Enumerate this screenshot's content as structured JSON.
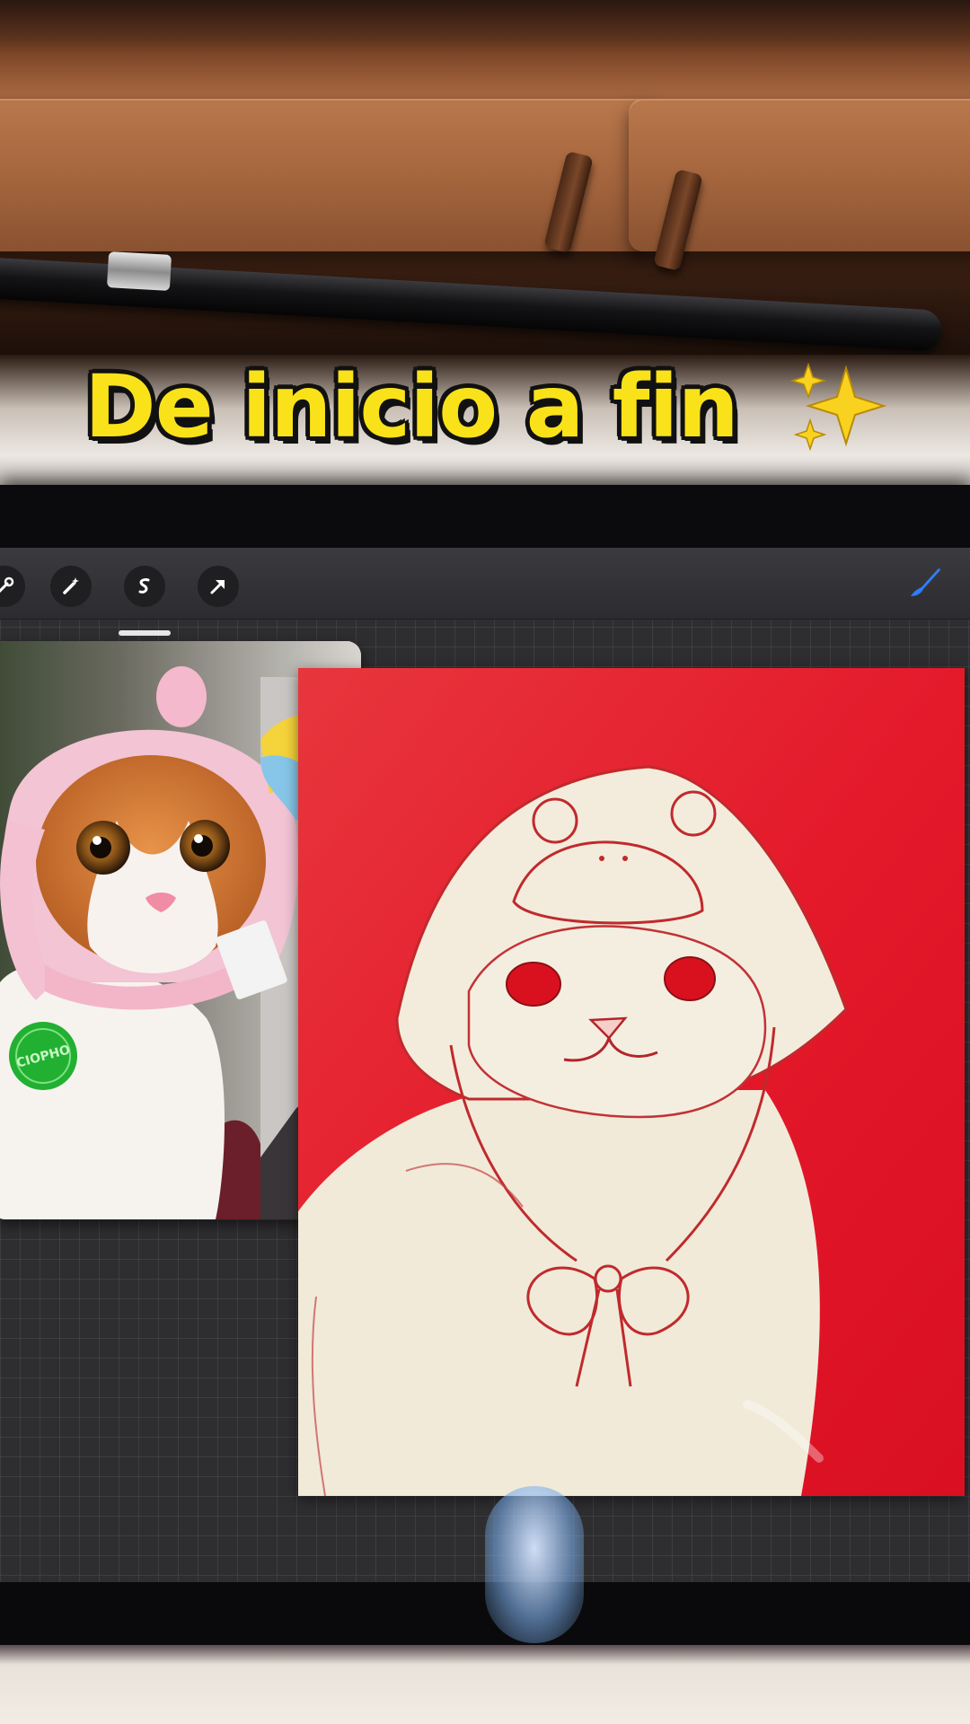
{
  "overlay": {
    "caption": "De inicio a fin",
    "caption_emoji_icon": "sparkles-icon",
    "caption_color": "#f9e21a"
  },
  "toolbar": {
    "icons": [
      "wrench-icon",
      "magic-wand-icon",
      "selection-icon",
      "move-arrow-icon",
      "brush-icon"
    ],
    "active_tool_color": "#2f7dff"
  },
  "reference": {
    "image": "cat-photo-in-pink-hat",
    "tag_text": "CIOPHO"
  },
  "canvas": {
    "background_color": "#e7192a",
    "sketch_color": "#b8212a"
  }
}
